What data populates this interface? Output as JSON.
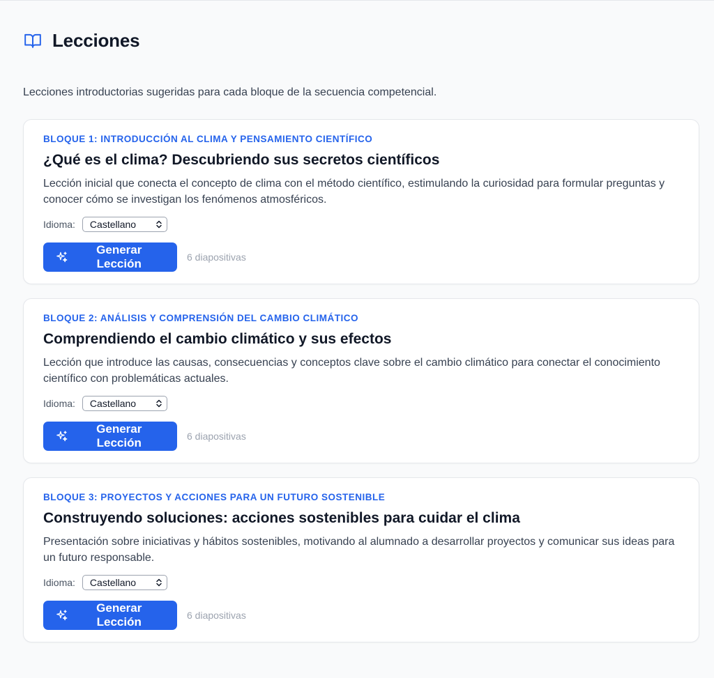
{
  "page": {
    "title": "Lecciones",
    "title_icon": "book-open-icon",
    "intro": "Lecciones introductorias sugeridas para cada bloque de la secuencia competencial."
  },
  "colors": {
    "accent": "#2563eb",
    "title": "#111827",
    "body": "#374151",
    "muted": "#9ca3af"
  },
  "lessons": [
    {
      "block_label": "BLOQUE 1: INTRODUCCIÓN AL CLIMA Y PENSAMIENTO CIENTÍFICO",
      "title": "¿Qué es el clima? Descubriendo sus secretos científicos",
      "description": "Lección inicial que conecta el concepto de clima con el método científico, estimulando la curiosidad para formular preguntas y conocer cómo se investigan los fenómenos atmosféricos.",
      "language_label": "Idioma:",
      "language_value": "Castellano",
      "button_label": "Generar Lección",
      "button_icon": "sparkles-icon",
      "slides": "6 diapositivas"
    },
    {
      "block_label": "BLOQUE 2: ANÁLISIS Y COMPRENSIÓN DEL CAMBIO CLIMÁTICO",
      "title": "Comprendiendo el cambio climático y sus efectos",
      "description": "Lección que introduce las causas, consecuencias y conceptos clave sobre el cambio climático para conectar el conocimiento científico con problemáticas actuales.",
      "language_label": "Idioma:",
      "language_value": "Castellano",
      "button_label": "Generar Lección",
      "button_icon": "sparkles-icon",
      "slides": "6 diapositivas"
    },
    {
      "block_label": "BLOQUE 3: PROYECTOS Y ACCIONES PARA UN FUTURO SOSTENIBLE",
      "title": "Construyendo soluciones: acciones sostenibles para cuidar el clima",
      "description": "Presentación sobre iniciativas y hábitos sostenibles, motivando al alumnado a desarrollar proyectos y comunicar sus ideas para un futuro responsable.",
      "language_label": "Idioma:",
      "language_value": "Castellano",
      "button_label": "Generar Lección",
      "button_icon": "sparkles-icon",
      "slides": "6 diapositivas"
    }
  ]
}
